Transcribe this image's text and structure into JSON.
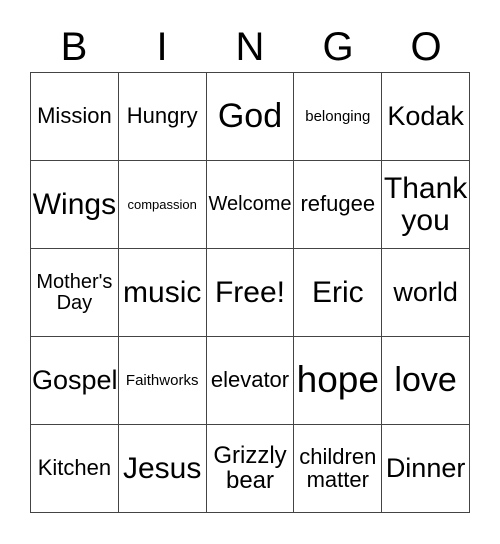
{
  "card": {
    "type": "bingo-card",
    "header_letters": [
      "B",
      "I",
      "N",
      "G",
      "O"
    ],
    "columns": 5,
    "rows": 5,
    "text_color": "#000000",
    "background_color": "#ffffff",
    "border_color": "#444444",
    "cells": [
      {
        "text": "Mission",
        "size": "fs-lg"
      },
      {
        "text": "Hungry",
        "size": "fs-lg"
      },
      {
        "text": "God",
        "size": "fs-4xl"
      },
      {
        "text": "belonging",
        "size": "fs-xs"
      },
      {
        "text": "Kodak",
        "size": "fs-2xl"
      },
      {
        "text": "Wings",
        "size": "fs-3xl"
      },
      {
        "text": "compassion",
        "size": "fs-xxs"
      },
      {
        "text": "Welcome",
        "size": "fs-md"
      },
      {
        "text": "refugee",
        "size": "fs-lg"
      },
      {
        "text": "Thank you",
        "size": "fs-3xl"
      },
      {
        "text": "Mother's Day",
        "size": "fs-md"
      },
      {
        "text": "music",
        "size": "fs-3xl"
      },
      {
        "text": "Free!",
        "size": "fs-3xl"
      },
      {
        "text": "Eric",
        "size": "fs-3xl"
      },
      {
        "text": "world",
        "size": "fs-2xl"
      },
      {
        "text": "Gospel",
        "size": "fs-2xl"
      },
      {
        "text": "Faithworks",
        "size": "fs-xs"
      },
      {
        "text": "elevator",
        "size": "fs-lg"
      },
      {
        "text": "hope",
        "size": "fs-5xl"
      },
      {
        "text": "love",
        "size": "fs-4xl"
      },
      {
        "text": "Kitchen",
        "size": "fs-lg"
      },
      {
        "text": "Jesus",
        "size": "fs-3xl"
      },
      {
        "text": "Grizzly bear",
        "size": "fs-xl"
      },
      {
        "text": "children matter",
        "size": "fs-lg"
      },
      {
        "text": "Dinner",
        "size": "fs-2xl"
      }
    ]
  }
}
